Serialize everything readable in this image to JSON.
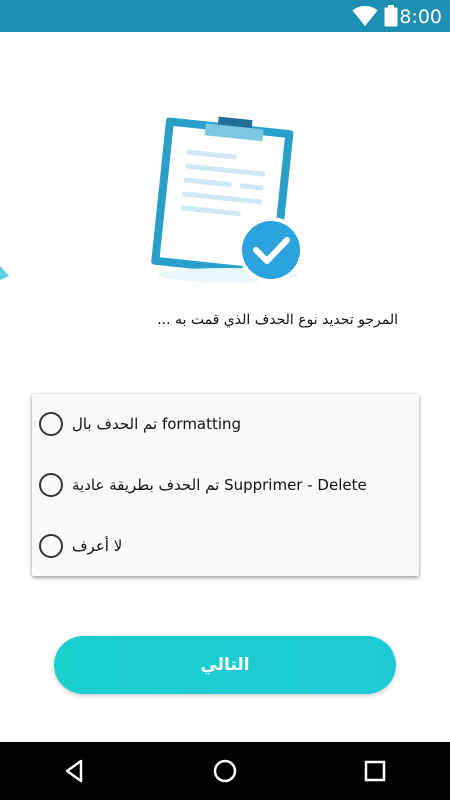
{
  "status_bar": {
    "time": "8:00",
    "icons": [
      "wifi-icon",
      "battery-icon"
    ]
  },
  "illustration": {
    "name": "clipboard-check-illustration",
    "colors": {
      "frame": "#2a9fc9",
      "paper": "#ffffff",
      "lines": "#cfe9f4",
      "clip": "#1f7fa6",
      "check_circle": "#2aa3df"
    }
  },
  "question": {
    "prompt": "المرجو تحديد نوع الحدف الذي قمت به ..."
  },
  "options": [
    {
      "label": "تم الحدف بال formatting",
      "selected": false
    },
    {
      "label": "تم الحدف بطريقة عادية Supprimer - Delete",
      "selected": false
    },
    {
      "label": "لا أعرف",
      "selected": false
    }
  ],
  "next_button": {
    "label": "التالي",
    "color": "#1dcdd1"
  },
  "nav_bar": {
    "icons": [
      "back-icon",
      "home-icon",
      "recents-icon"
    ]
  }
}
